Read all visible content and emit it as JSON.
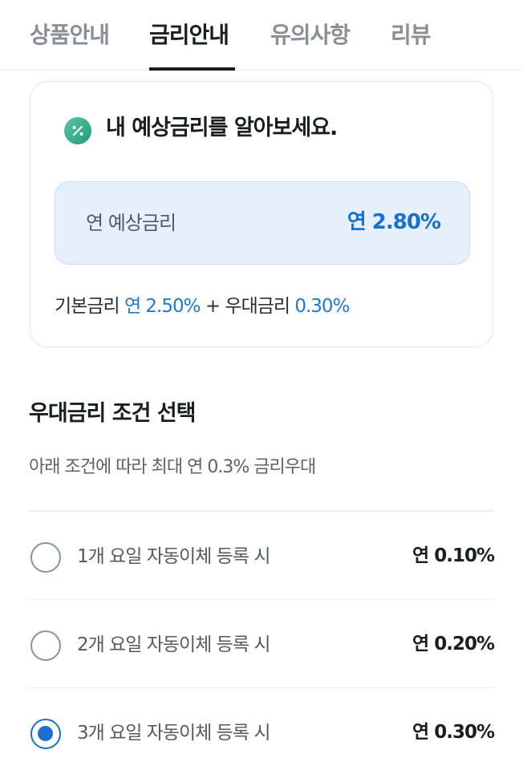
{
  "tabs": [
    {
      "label": "상품안내",
      "active": false
    },
    {
      "label": "금리안내",
      "active": true
    },
    {
      "label": "유의사항",
      "active": false
    },
    {
      "label": "리뷰",
      "active": false
    }
  ],
  "estimate_card": {
    "icon": "percent-icon",
    "title": "내 예상금리를 알아보세요.",
    "rate_label": "연 예상금리",
    "rate_value": "연 2.80%",
    "base_label": "기본금리",
    "base_value": "연 2.50%",
    "plus": "+",
    "bonus_label": "우대금리",
    "bonus_value": "0.30%"
  },
  "preferential": {
    "title": "우대금리 조건 선택",
    "subtitle": "아래 조건에 따라 최대 연 0.3% 금리우대",
    "options": [
      {
        "label": "1개 요일 자동이체 등록 시",
        "rate": "연 0.10%",
        "selected": false
      },
      {
        "label": "2개 요일 자동이체 등록 시",
        "rate": "연 0.20%",
        "selected": false
      },
      {
        "label": "3개 요일 자동이체 등록 시",
        "rate": "연 0.30%",
        "selected": true
      }
    ]
  },
  "colors": {
    "accent": "#1a6fd0",
    "icon_green": "#1f9d78",
    "rate_box_bg": "#e6f0fb"
  }
}
